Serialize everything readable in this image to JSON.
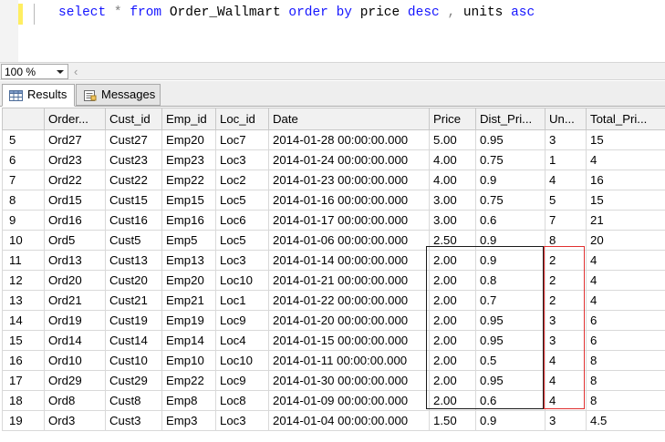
{
  "editor": {
    "tokens": [
      {
        "t": "select",
        "c": "kw"
      },
      {
        "t": " ",
        "c": "id"
      },
      {
        "t": "*",
        "c": "op"
      },
      {
        "t": " ",
        "c": "id"
      },
      {
        "t": "from",
        "c": "kw"
      },
      {
        "t": " Order_Wallmart ",
        "c": "id"
      },
      {
        "t": "order by",
        "c": "kw"
      },
      {
        "t": " price ",
        "c": "id"
      },
      {
        "t": "desc",
        "c": "kw"
      },
      {
        "t": " ",
        "c": "id"
      },
      {
        "t": ",",
        "c": "op"
      },
      {
        "t": " units ",
        "c": "id"
      },
      {
        "t": "asc",
        "c": "kw"
      }
    ]
  },
  "zoom": {
    "value": "100 %"
  },
  "tabs": [
    {
      "label": "Results",
      "icon": "grid-icon"
    },
    {
      "label": "Messages",
      "icon": "messages-icon"
    }
  ],
  "grid": {
    "columns": [
      "",
      "Order...",
      "Cust_id",
      "Emp_id",
      "Loc_id",
      "Date",
      "Price",
      "Dist_Pri...",
      "Un...",
      "Total_Pri..."
    ],
    "rows": [
      [
        "5",
        "Ord27",
        "Cust27",
        "Emp20",
        "Loc7",
        "2014-01-28 00:00:00.000",
        "5.00",
        "0.95",
        "3",
        "15"
      ],
      [
        "6",
        "Ord23",
        "Cust23",
        "Emp23",
        "Loc3",
        "2014-01-24 00:00:00.000",
        "4.00",
        "0.75",
        "1",
        "4"
      ],
      [
        "7",
        "Ord22",
        "Cust22",
        "Emp22",
        "Loc2",
        "2014-01-23 00:00:00.000",
        "4.00",
        "0.9",
        "4",
        "16"
      ],
      [
        "8",
        "Ord15",
        "Cust15",
        "Emp15",
        "Loc5",
        "2014-01-16 00:00:00.000",
        "3.00",
        "0.75",
        "5",
        "15"
      ],
      [
        "9",
        "Ord16",
        "Cust16",
        "Emp16",
        "Loc6",
        "2014-01-17 00:00:00.000",
        "3.00",
        "0.6",
        "7",
        "21"
      ],
      [
        "10",
        "Ord5",
        "Cust5",
        "Emp5",
        "Loc5",
        "2014-01-06 00:00:00.000",
        "2.50",
        "0.9",
        "8",
        "20"
      ],
      [
        "11",
        "Ord13",
        "Cust13",
        "Emp13",
        "Loc3",
        "2014-01-14 00:00:00.000",
        "2.00",
        "0.9",
        "2",
        "4"
      ],
      [
        "12",
        "Ord20",
        "Cust20",
        "Emp20",
        "Loc10",
        "2014-01-21 00:00:00.000",
        "2.00",
        "0.8",
        "2",
        "4"
      ],
      [
        "13",
        "Ord21",
        "Cust21",
        "Emp21",
        "Loc1",
        "2014-01-22 00:00:00.000",
        "2.00",
        "0.7",
        "2",
        "4"
      ],
      [
        "14",
        "Ord19",
        "Cust19",
        "Emp19",
        "Loc9",
        "2014-01-20 00:00:00.000",
        "2.00",
        "0.95",
        "3",
        "6"
      ],
      [
        "15",
        "Ord14",
        "Cust14",
        "Emp14",
        "Loc4",
        "2014-01-15 00:00:00.000",
        "2.00",
        "0.95",
        "3",
        "6"
      ],
      [
        "16",
        "Ord10",
        "Cust10",
        "Emp10",
        "Loc10",
        "2014-01-11 00:00:00.000",
        "2.00",
        "0.5",
        "4",
        "8"
      ],
      [
        "17",
        "Ord29",
        "Cust29",
        "Emp22",
        "Loc9",
        "2014-01-30 00:00:00.000",
        "2.00",
        "0.95",
        "4",
        "8"
      ],
      [
        "18",
        "Ord8",
        "Cust8",
        "Emp8",
        "Loc8",
        "2014-01-09 00:00:00.000",
        "2.00",
        "0.6",
        "4",
        "8"
      ],
      [
        "19",
        "Ord3",
        "Cust3",
        "Emp3",
        "Loc3",
        "2014-01-04 00:00:00.000",
        "1.50",
        "0.9",
        "3",
        "4.5"
      ]
    ]
  },
  "colors": {
    "keyword": "#1515ff",
    "operator": "#808080",
    "highlight_box": "#1a1a1a",
    "units_box": "#e03030"
  }
}
